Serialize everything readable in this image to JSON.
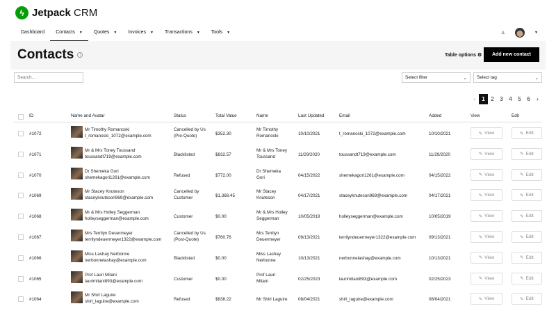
{
  "app": {
    "logo_bold": "Jetpack",
    "logo_rest": " CRM"
  },
  "nav": [
    {
      "label": "Dashboard",
      "dropdown": false
    },
    {
      "label": "Contacts",
      "dropdown": true,
      "active": true
    },
    {
      "label": "Quotes",
      "dropdown": true
    },
    {
      "label": "Invoices",
      "dropdown": true
    },
    {
      "label": "Transactions",
      "dropdown": true
    },
    {
      "label": "Tools",
      "dropdown": true
    }
  ],
  "page": {
    "title": "Contacts",
    "table_options": "Table options",
    "add_button": "Add new contact"
  },
  "search": {
    "placeholder": "Search..."
  },
  "filters": {
    "filter": "Select filter",
    "tag": "Select tag"
  },
  "pagination": {
    "pages": [
      "1",
      "2",
      "3",
      "4",
      "5",
      "6"
    ],
    "current": "1"
  },
  "columns": [
    "ID",
    "Name and Avatar",
    "Status",
    "Total Value",
    "Name",
    "Last Updated",
    "Email",
    "Added",
    "View",
    "Edit"
  ],
  "buttons": {
    "view": "View",
    "edit": "Edit"
  },
  "rows": [
    {
      "id": "#1072",
      "name": "Mr Timothy Romanoski",
      "email": "t_romanoski_1072@example.com",
      "status": [
        "Cancelled by Us",
        "(Pre-Quote)"
      ],
      "total": "$352.30",
      "name_col": [
        "Mr Timothy",
        "Romanoski"
      ],
      "updated": "10/10/2021",
      "added": "10/10/2021"
    },
    {
      "id": "#1071",
      "name": "Mr & Mrs Toney Toussand",
      "email": "toussandt719@example.com",
      "status": [
        "Blacklisted"
      ],
      "total": "$832.57",
      "name_col": [
        "Mr & Mrs Toney",
        "Toussand"
      ],
      "updated": "11/29/2020",
      "added": "11/29/2020"
    },
    {
      "id": "#1070",
      "name": "Dr Shemeka Gori",
      "email": "shemekagori1261@example.com",
      "status": [
        "Refused"
      ],
      "total": "$772.00",
      "name_col": [
        "Dr Shemeka",
        "Gori"
      ],
      "updated": "04/15/2022",
      "added": "04/15/2022"
    },
    {
      "id": "#1069",
      "name": "Mr Stacey Knuteson",
      "email": "staceyknuteson969@example.com",
      "status": [
        "Cancelled by",
        "Customer"
      ],
      "total": "$1,368.45",
      "name_col": [
        "Mr Stacey",
        "Knuteson"
      ],
      "updated": "04/17/2021",
      "added": "04/17/2021"
    },
    {
      "id": "#1068",
      "name": "Mr & Mrs Holley Seggerman",
      "email": "holleyseggerman@example.com",
      "status": [
        "Customer"
      ],
      "total": "$0.00",
      "name_col": [
        "Mr & Mrs Holley",
        "Seggerman"
      ],
      "updated": "10/05/2019",
      "added": "10/05/2019"
    },
    {
      "id": "#1067",
      "name": "Mrs Terrilyn Deuermeyer",
      "email": "terrilyndeuermeyer1322@example.com",
      "status": [
        "Cancelled by Us",
        "(Post-Quote)"
      ],
      "total": "$760.76",
      "name_col": [
        "Mrs Terrilyn",
        "Deuermeyer"
      ],
      "updated": "09/13/2021",
      "added": "09/13/2021"
    },
    {
      "id": "#1066",
      "name": "Miss Lashay Nerbonne",
      "email": "nerbonnelashay@example.com",
      "status": [
        "Blacklisted"
      ],
      "total": "$0.00",
      "name_col": [
        "Miss Lashay",
        "Nerbonne"
      ],
      "updated": "10/13/2021",
      "added": "10/13/2021"
    },
    {
      "id": "#1065",
      "name": "Prof Lauri Mitani",
      "email": "laurimitani893@example.com",
      "status": [
        "Customer"
      ],
      "total": "$0.00",
      "name_col": [
        "Prof Lauri",
        "Mitani"
      ],
      "updated": "02/25/2023",
      "added": "02/25/2023"
    },
    {
      "id": "#1064",
      "name": "Mr Shirl Laguire",
      "email": "shirl_laguire@example.com",
      "status": [
        "Refused"
      ],
      "total": "$838.22",
      "name_col": [
        "Mr Shirl Laguire"
      ],
      "updated": "08/04/2021",
      "added": "08/04/2021"
    }
  ]
}
